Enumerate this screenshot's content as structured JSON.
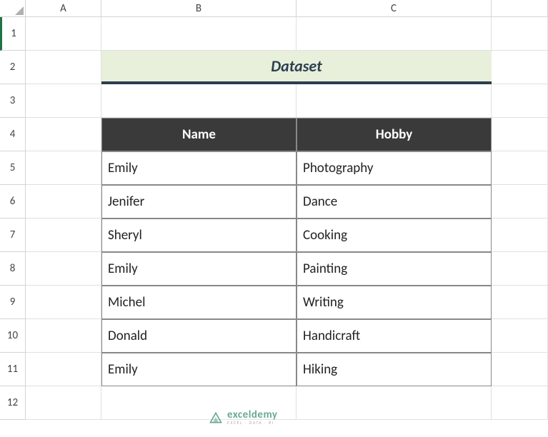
{
  "columns": [
    "A",
    "B",
    "C"
  ],
  "rows": [
    "1",
    "2",
    "3",
    "4",
    "5",
    "6",
    "7",
    "8",
    "9",
    "10",
    "11",
    "12"
  ],
  "title": "Dataset",
  "headers": {
    "name": "Name",
    "hobby": "Hobby"
  },
  "table": [
    {
      "name": "Emily",
      "hobby": "Photography"
    },
    {
      "name": "Jenifer",
      "hobby": "Dance"
    },
    {
      "name": "Sheryl",
      "hobby": "Cooking"
    },
    {
      "name": "Emily",
      "hobby": "Painting"
    },
    {
      "name": "Michel",
      "hobby": "Writing"
    },
    {
      "name": "Donald",
      "hobby": "Handicraft"
    },
    {
      "name": "Emily",
      "hobby": "Hiking"
    }
  ],
  "watermark": {
    "brand": "exceldemy",
    "tagline": "EXCEL · DATA · BI"
  },
  "colors": {
    "banner_bg": "#e8efdb",
    "banner_border": "#2c3e50",
    "header_bg": "#3a3a3a",
    "accent": "#217346"
  }
}
